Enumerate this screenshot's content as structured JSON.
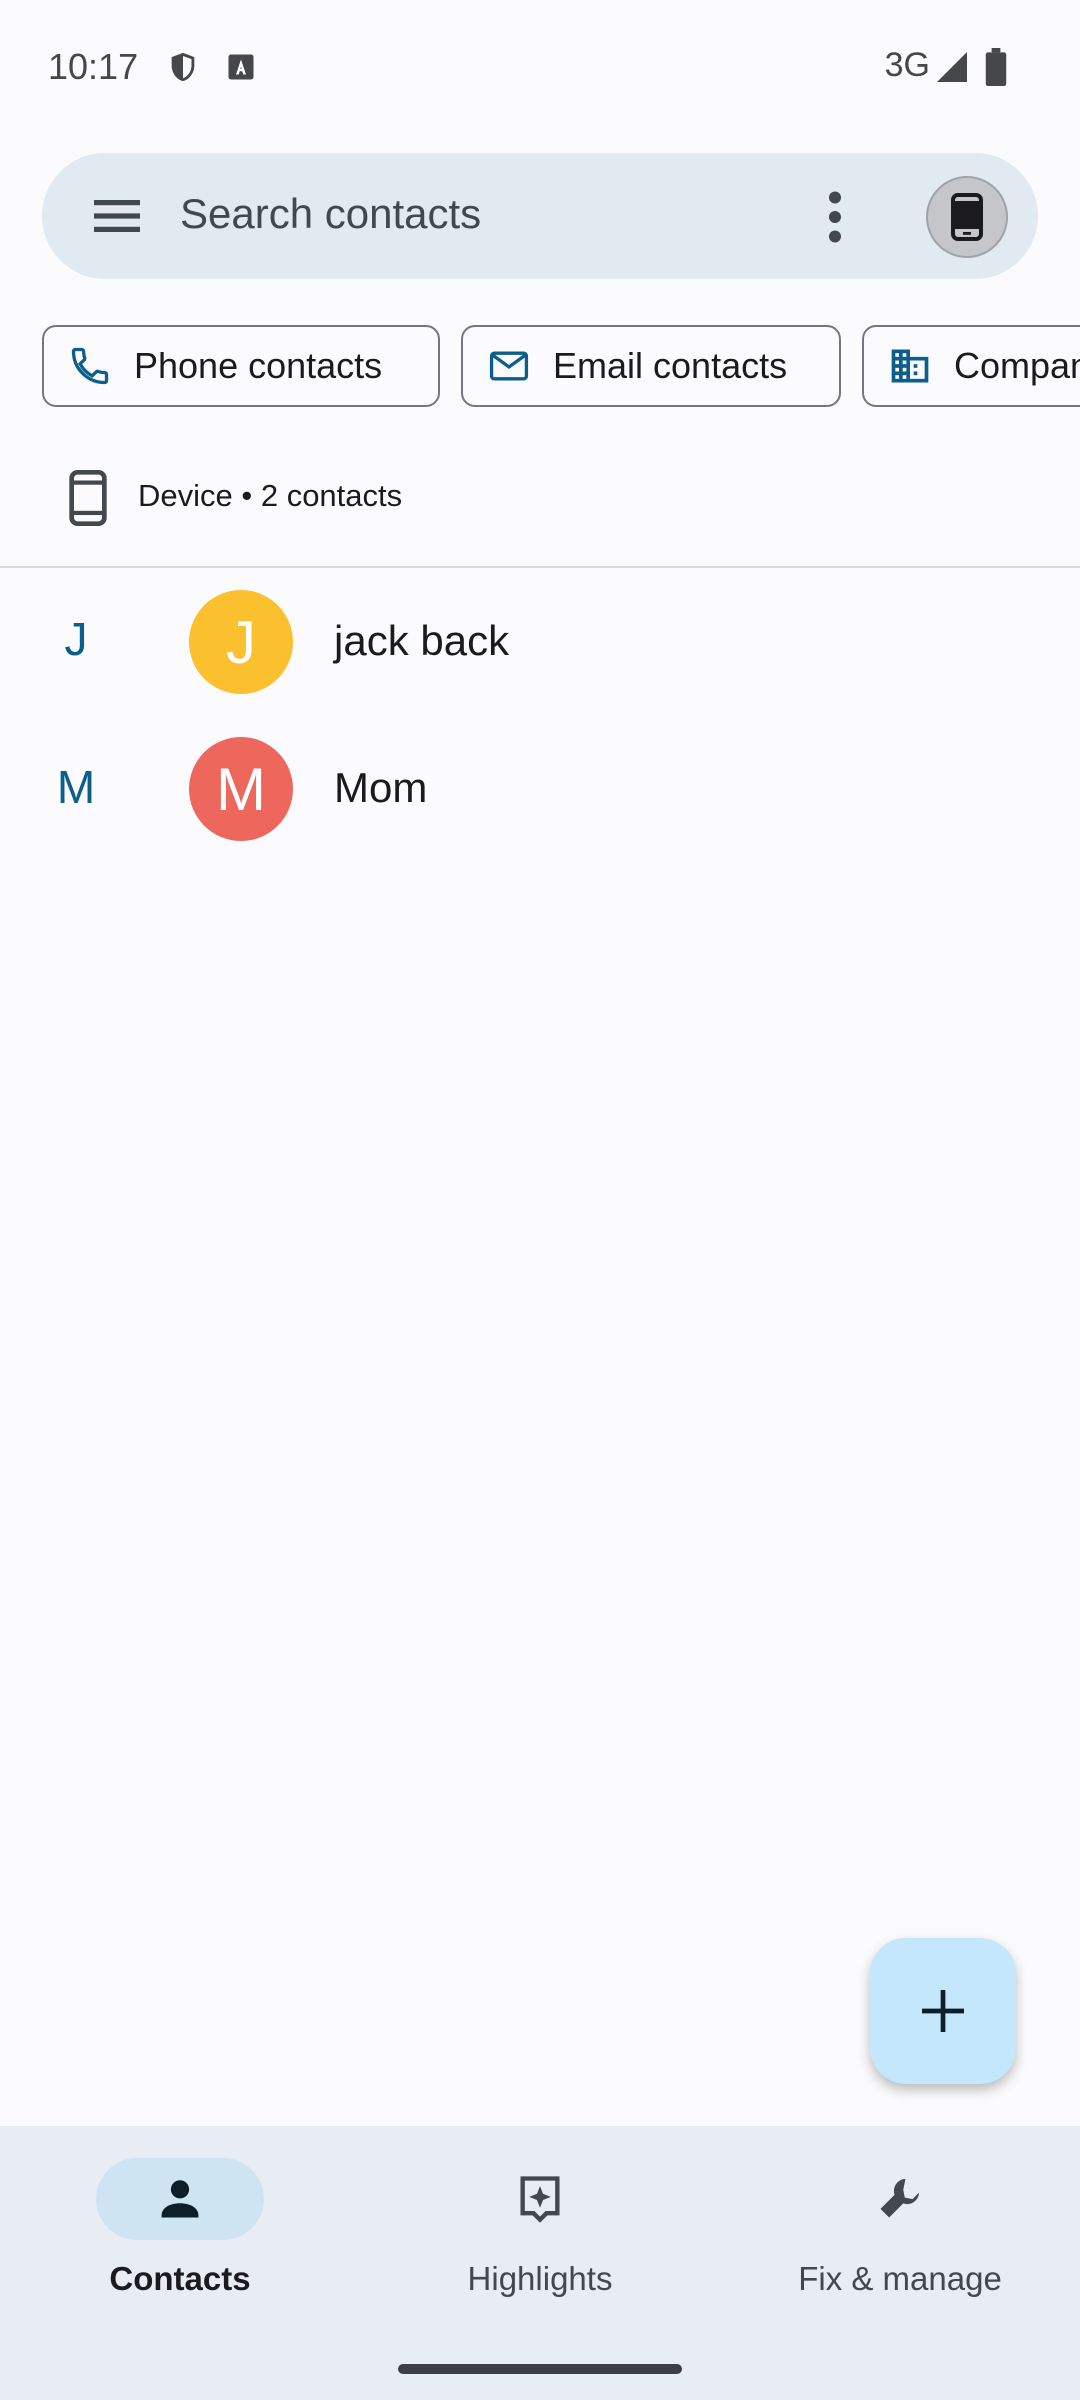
{
  "status_bar": {
    "time": "10:17",
    "network": "3G",
    "icons": [
      "shield-icon",
      "keyboard-a-icon",
      "signal-icon",
      "battery-icon"
    ]
  },
  "search": {
    "placeholder": "Search contacts",
    "icons": [
      "menu-icon",
      "more-vert-icon",
      "device-phone-icon"
    ]
  },
  "chips": [
    {
      "label": "Phone contacts",
      "icon": "phone-icon"
    },
    {
      "label": "Email contacts",
      "icon": "mail-icon"
    },
    {
      "label": "Companies",
      "icon": "business-icon"
    }
  ],
  "account": {
    "label": "Device • 2 contacts",
    "icon": "device-phone-icon"
  },
  "contacts": [
    {
      "section_letter": "J",
      "initial": "J",
      "name": "jack back",
      "avatar_color": "#fbc02d"
    },
    {
      "section_letter": "M",
      "initial": "M",
      "name": "Mom",
      "avatar_color": "#ee675c"
    }
  ],
  "fab": {
    "icon": "add-icon"
  },
  "bottom_nav": {
    "items": [
      {
        "label": "Contacts",
        "icon": "person-icon",
        "active": true
      },
      {
        "label": "Highlights",
        "icon": "highlights-icon",
        "active": false
      },
      {
        "label": "Fix & manage",
        "icon": "wrench-icon",
        "active": false
      }
    ]
  },
  "colors": {
    "accent": "#0b5f8a",
    "search_bg": "#e1eaf0",
    "fab_bg": "#c5e7fb",
    "nav_bg": "#e7edf3"
  }
}
